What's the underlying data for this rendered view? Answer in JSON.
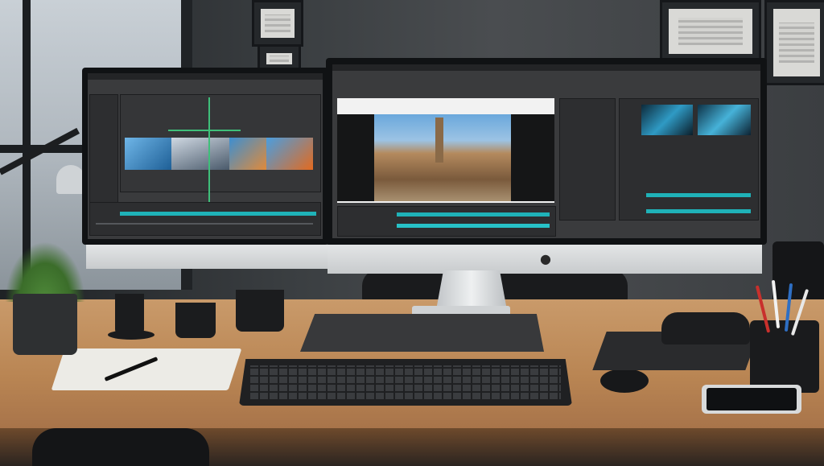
{
  "scene": {
    "description_tags": [
      "desk",
      "dual-monitor",
      "video-editing-software",
      "keyboard",
      "mouse",
      "plant",
      "mugs",
      "pen-cup",
      "phone",
      "notebook"
    ],
    "colors": {
      "wall": "#3a3e41",
      "desk_wood": "#b98553",
      "timeline_accent": "#1fb2b8",
      "ui_dark": "#2d2e30"
    }
  }
}
